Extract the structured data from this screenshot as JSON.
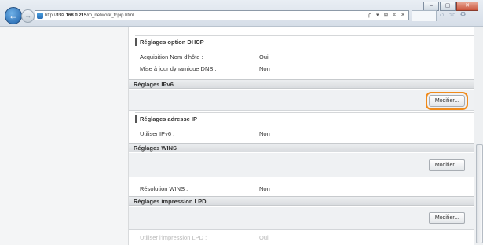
{
  "browser": {
    "url_prefix": "http://",
    "url_host": "192.168.0.215",
    "url_path": "/m_network_tcpip.html",
    "addr_tools": "ρ ▾ ⊠ ¢ ✕",
    "window_buttons": [
      "–",
      "▢",
      "✕"
    ],
    "toolbar_icons": [
      "⌂",
      "☆",
      "⚙"
    ]
  },
  "dhcp": {
    "heading": "Réglages option DHCP",
    "rows": [
      {
        "label": "Acquisition Nom d'hôte :",
        "value": "Oui"
      },
      {
        "label": "Mise à jour dynamique DNS :",
        "value": "Non"
      }
    ]
  },
  "ipv6": {
    "title": "Réglages IPv6",
    "button": "Modifier..."
  },
  "ip_address": {
    "heading": "Réglages adresse IP",
    "rows": [
      {
        "label": "Utiliser IPv6 :",
        "value": "Non"
      }
    ]
  },
  "wins": {
    "title": "Réglages WINS",
    "button": "Modifier...",
    "rows": [
      {
        "label": "Résolution WINS :",
        "value": "Non"
      }
    ]
  },
  "lpd": {
    "title": "Réglages impression LPD",
    "button": "Modifier...",
    "rows": [
      {
        "label": "Utiliser l'impression LPD :",
        "value": "Oui"
      }
    ]
  },
  "colors": {
    "highlight": "#f08a1a",
    "section_bar": "#dcdfe2"
  }
}
